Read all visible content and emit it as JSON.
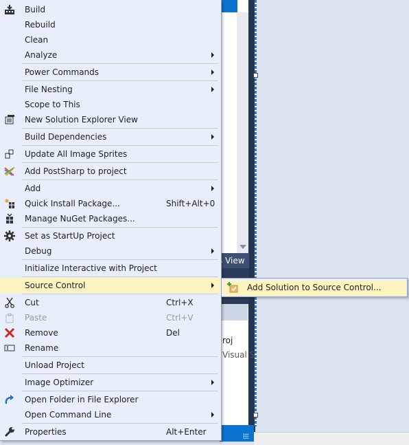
{
  "background": {
    "explorer_tab_label": "s View",
    "explorer_item_name": "roj",
    "explorer_item_sub": "Visual S"
  },
  "menu": {
    "items": [
      {
        "label": "Build",
        "icon": "build-icon"
      },
      {
        "label": "Rebuild"
      },
      {
        "label": "Clean"
      },
      {
        "label": "Analyze",
        "submenu": true
      },
      {
        "separator": true
      },
      {
        "label": "Power Commands",
        "submenu": true
      },
      {
        "separator": true
      },
      {
        "label": "File Nesting",
        "submenu": true
      },
      {
        "label": "Scope to This"
      },
      {
        "label": "New Solution Explorer View",
        "icon": "new-window-icon"
      },
      {
        "separator": true
      },
      {
        "label": "Build Dependencies",
        "submenu": true
      },
      {
        "separator": true
      },
      {
        "label": "Update All Image Sprites",
        "icon": "sprites-icon"
      },
      {
        "separator": true
      },
      {
        "label": "Add PostSharp to project",
        "icon": "postsharp-icon"
      },
      {
        "separator": true
      },
      {
        "label": "Add",
        "submenu": true
      },
      {
        "label": "Quick Install Package...",
        "icon": "quick-install-icon",
        "shortcut": "Shift+Alt+0"
      },
      {
        "label": "Manage NuGet Packages...",
        "icon": "nuget-icon"
      },
      {
        "separator": true
      },
      {
        "label": "Set as StartUp Project",
        "icon": "gear-icon"
      },
      {
        "label": "Debug",
        "submenu": true
      },
      {
        "separator": true
      },
      {
        "label": "Initialize Interactive with Project"
      },
      {
        "separator": true
      },
      {
        "label": "Source Control",
        "submenu": true,
        "highlighted": true
      },
      {
        "separator": true
      },
      {
        "label": "Cut",
        "icon": "scissors-icon",
        "shortcut": "Ctrl+X"
      },
      {
        "label": "Paste",
        "icon": "paste-icon",
        "shortcut": "Ctrl+V",
        "disabled": true
      },
      {
        "label": "Remove",
        "icon": "remove-icon",
        "shortcut": "Del"
      },
      {
        "label": "Rename",
        "icon": "rename-icon"
      },
      {
        "separator": true
      },
      {
        "label": "Unload Project"
      },
      {
        "separator": true
      },
      {
        "label": "Image Optimizer",
        "submenu": true
      },
      {
        "separator": true
      },
      {
        "label": "Open Folder in File Explorer",
        "icon": "open-folder-icon"
      },
      {
        "label": "Open Command Line",
        "submenu": true
      },
      {
        "separator": true
      },
      {
        "label": "Properties",
        "icon": "wrench-icon",
        "shortcut": "Alt+Enter"
      }
    ]
  },
  "submenu": {
    "parent": "Source Control",
    "items": [
      {
        "label": "Add Solution to Source Control...",
        "icon": "add-to-source-control-icon",
        "highlighted": true
      }
    ]
  },
  "colors": {
    "menu_bg": "#e9eefc",
    "highlight_bg": "#fdf4bf",
    "accent_blue": "#0a74d0",
    "remove_red": "#d0271d"
  }
}
